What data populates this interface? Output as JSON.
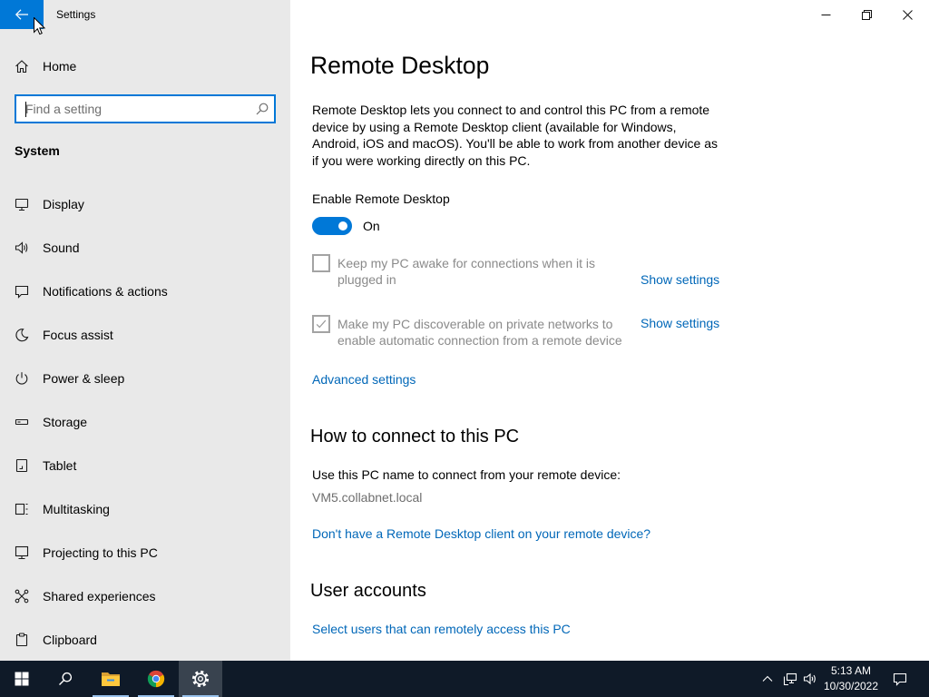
{
  "colors": {
    "accent": "#0078d7",
    "link": "#0067b8",
    "sidebar_bg": "#e9e9e9",
    "taskbar_bg": "#0f1a28"
  },
  "window": {
    "title": "Settings",
    "controls": [
      "minimize-icon",
      "restore-icon",
      "close-icon"
    ]
  },
  "sidebar": {
    "home_label": "Home",
    "search": {
      "placeholder": "Find a setting",
      "value": ""
    },
    "section_title": "System",
    "items": [
      {
        "label": "Display",
        "icon": "display-icon"
      },
      {
        "label": "Sound",
        "icon": "sound-icon"
      },
      {
        "label": "Notifications & actions",
        "icon": "notifications-icon"
      },
      {
        "label": "Focus assist",
        "icon": "focus-assist-icon"
      },
      {
        "label": "Power & sleep",
        "icon": "power-icon"
      },
      {
        "label": "Storage",
        "icon": "storage-icon"
      },
      {
        "label": "Tablet",
        "icon": "tablet-icon"
      },
      {
        "label": "Multitasking",
        "icon": "multitasking-icon"
      },
      {
        "label": "Projecting to this PC",
        "icon": "projecting-icon"
      },
      {
        "label": "Shared experiences",
        "icon": "shared-experiences-icon"
      },
      {
        "label": "Clipboard",
        "icon": "clipboard-icon"
      }
    ]
  },
  "main": {
    "title": "Remote Desktop",
    "description": "Remote Desktop lets you connect to and control this PC from a remote device by using a Remote Desktop client (available for Windows, Android, iOS and macOS). You'll be able to work from another device as if you were working directly on this PC.",
    "enable_label": "Enable Remote Desktop",
    "toggle": {
      "on": true,
      "state_label": "On"
    },
    "options": [
      {
        "text": "Keep my PC awake for connections when it is plugged in",
        "checked": false,
        "link": "Show settings"
      },
      {
        "text": "Make my PC discoverable on private networks to enable automatic connection from a remote device",
        "checked": true,
        "link": "Show settings"
      }
    ],
    "advanced_link": "Advanced settings",
    "connect": {
      "heading": "How to connect to this PC",
      "instruction": "Use this PC name to connect from your remote device:",
      "pc_name": "VM5.collabnet.local",
      "client_link": "Don't have a Remote Desktop client on your remote device?"
    },
    "accounts": {
      "heading": "User accounts",
      "link": "Select users that can remotely access this PC"
    }
  },
  "taskbar": {
    "buttons": [
      {
        "icon": "start-windows-icon",
        "running": false,
        "active": false
      },
      {
        "icon": "search-icon",
        "running": false,
        "active": false
      },
      {
        "icon": "file-explorer-icon",
        "running": true,
        "active": false
      },
      {
        "icon": "chrome-icon",
        "running": true,
        "active": false
      },
      {
        "icon": "settings-gear-icon",
        "running": true,
        "active": true
      }
    ],
    "tray": {
      "icons": [
        "chevron-up-icon",
        "network-icon",
        "volume-icon",
        "action-center-icon"
      ],
      "time": "5:13 AM",
      "date": "10/30/2022"
    }
  }
}
